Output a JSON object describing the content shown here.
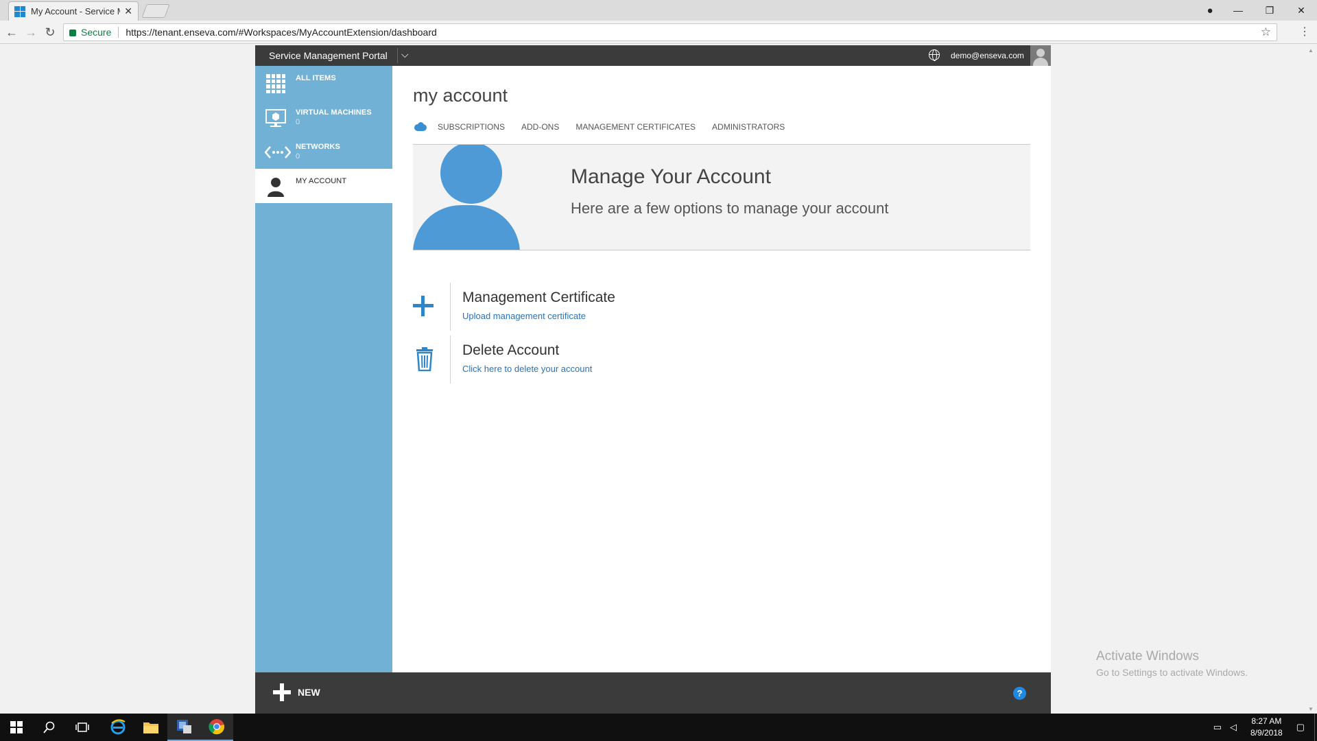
{
  "browser": {
    "tab_title": "My Account - Service Ma",
    "tab_close": "✕",
    "secure_label": "Secure",
    "url": "https://tenant.enseva.com/#Workspaces/MyAccountExtension/dashboard"
  },
  "portal": {
    "brand": "Service Management Portal",
    "user_email": "demo@enseva.com"
  },
  "sidebar": {
    "items": [
      {
        "label": "ALL ITEMS",
        "count": ""
      },
      {
        "label": "VIRTUAL MACHINES",
        "count": "0"
      },
      {
        "label": "NETWORKS",
        "count": "0"
      },
      {
        "label": "MY ACCOUNT",
        "count": ""
      }
    ]
  },
  "main": {
    "title": "my account",
    "tabs": [
      "SUBSCRIPTIONS",
      "ADD-ONS",
      "MANAGEMENT CERTIFICATES",
      "ADMINISTRATORS"
    ],
    "hero": {
      "title": "Manage Your Account",
      "subtitle": "Here are a few options to manage your account"
    },
    "actions": [
      {
        "title": "Management Certificate",
        "link": "Upload management certificate",
        "icon": "plus-icon"
      },
      {
        "title": "Delete Account",
        "link": "Click here to delete your account",
        "icon": "trash-icon"
      }
    ]
  },
  "bottombar": {
    "new_label": "NEW",
    "help_label": "?"
  },
  "watermark": {
    "line1": "Activate Windows",
    "line2": "Go to Settings to activate Windows."
  },
  "taskbar": {
    "time": "8:27 AM",
    "date": "8/9/2018"
  },
  "colors": {
    "sidebar": "#71b1d6",
    "accent": "#2d86c9",
    "topbar": "#3b3b3b"
  }
}
